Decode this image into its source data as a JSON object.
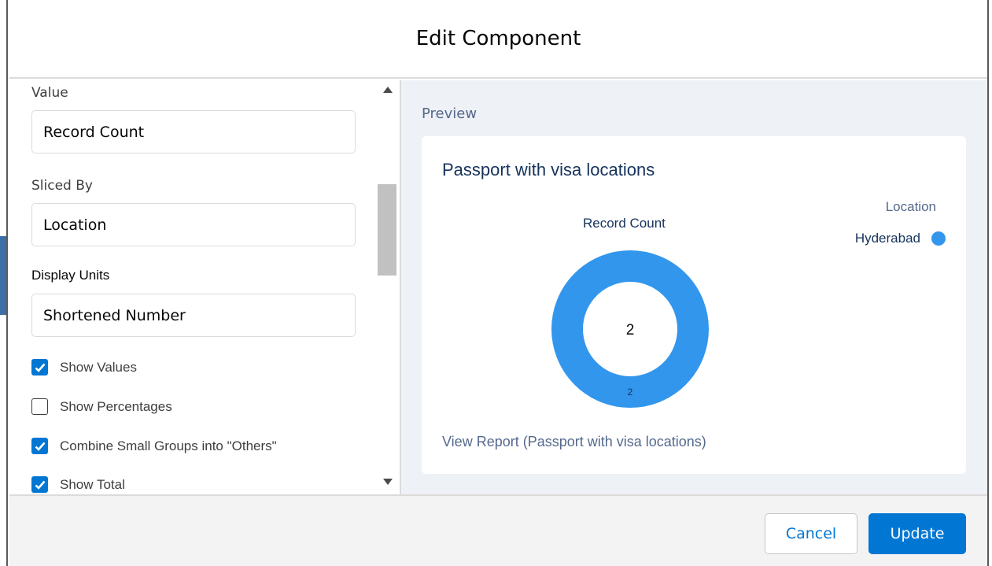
{
  "modal": {
    "title": "Edit Component"
  },
  "form": {
    "value_label": "Value",
    "value_field": "Record Count",
    "sliced_by_label": "Sliced By",
    "sliced_by_field": "Location",
    "display_units_label": "Display Units",
    "display_units_field": "Shortened Number",
    "checkboxes": [
      {
        "label": "Show Values",
        "checked": true
      },
      {
        "label": "Show Percentages",
        "checked": false
      },
      {
        "label": "Combine Small Groups into \"Others\"",
        "checked": true
      },
      {
        "label": "Show Total",
        "checked": true
      }
    ]
  },
  "preview": {
    "label": "Preview",
    "card_title": "Passport with visa locations",
    "chart_label": "Record Count",
    "legend_title": "Location",
    "total": "2",
    "view_report": "View Report (Passport with visa locations)"
  },
  "chart_data": {
    "type": "pie",
    "title": "Passport with visa locations",
    "categories": [
      "Hyderabad"
    ],
    "values": [
      2
    ],
    "total": 2,
    "legend_title": "Location",
    "legend_position": "top-right",
    "colors": [
      "#3296ed"
    ]
  },
  "footer": {
    "cancel_label": "Cancel",
    "update_label": "Update"
  },
  "colors": {
    "brand": "#0176d3",
    "slice": "#3296ed",
    "preview_bg": "#eef1f6"
  }
}
